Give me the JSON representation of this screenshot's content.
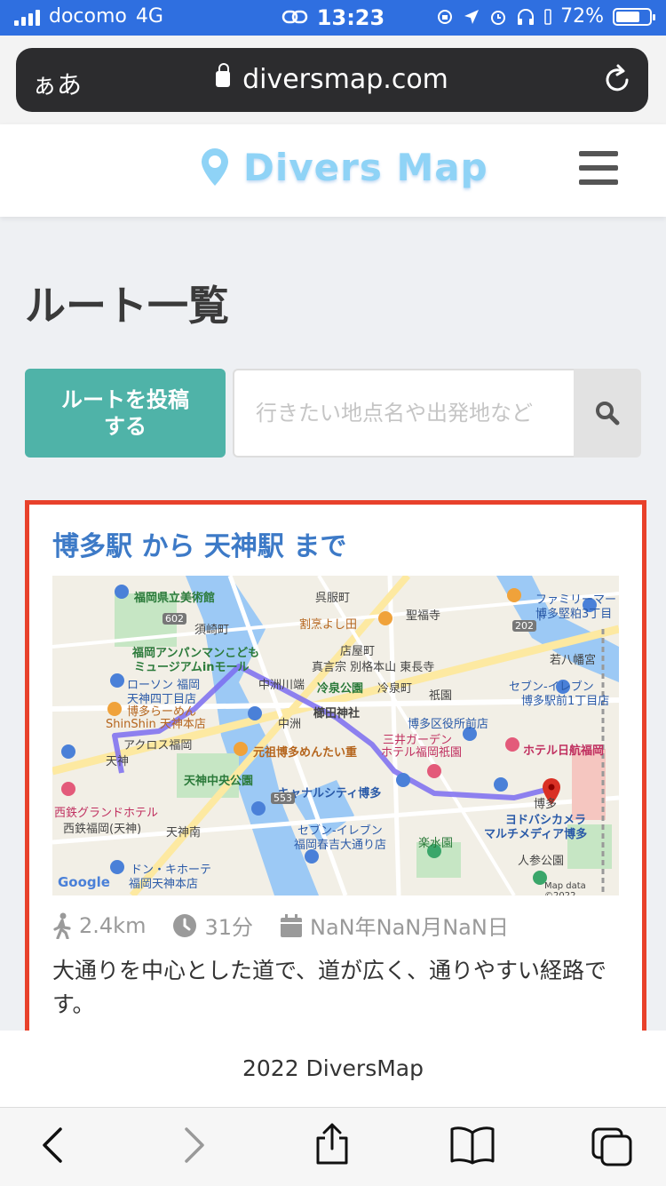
{
  "status_bar": {
    "carrier": "docomo",
    "network": "4G",
    "time": "13:23",
    "battery": "72%"
  },
  "browser": {
    "text_size_label": "ぁあ",
    "url": "diversmap.com"
  },
  "site": {
    "logo_text": "Divers Map"
  },
  "page": {
    "title": "ルート一覧",
    "post_button_label": "ルートを投稿する",
    "search_placeholder": "行きたい地点名や出発地など"
  },
  "route_card": {
    "title": "博多駅 から 天神駅 まで",
    "distance": "2.4km",
    "duration": "31分",
    "date": "NaN年NaN月NaN日",
    "description": "大通りを中心とした道で、道が広く、通りやすい経路です。",
    "map": {
      "labels": [
        "福岡県立美術館",
        "須崎町",
        "呉服町",
        "聖福寺",
        "割烹よし田",
        "福岡アンパンマンこども",
        "ミュージアムinモール",
        "店屋町",
        "真言宗 別格本山 東長寺",
        "冷泉公園",
        "冷泉町",
        "ローソン 福岡",
        "天神四丁目店",
        "中洲川端",
        "櫛田神社",
        "祇園",
        "博多らーめん",
        "ShinShin 天神本店",
        "中洲",
        "アクロス福岡",
        "元祖博多めんたい重",
        "三井ガーデン",
        "ホテル福岡祇園",
        "天神",
        "天神中央公園",
        "キャナルシティ博多",
        "西鉄グランドホテル",
        "西鉄福岡(天神)",
        "天神南",
        "セブン-イレブン",
        "福岡春吉大通り店",
        "ドン・キホーテ",
        "福岡天神本店",
        "楽水園",
        "ホテル日航福岡",
        "ヨドバシカメラ",
        "マルチメディア博多",
        "博多",
        "人参公園",
        "若八幡宮",
        "セブン-イレブン",
        "博多駅前1丁目店",
        "ファミリーマート",
        "博多堅粕3丁目",
        "博多区役所前店",
        "Google",
        "Map data ©2022",
        "602",
        "553",
        "202"
      ]
    }
  },
  "footer": {
    "copyright": "2022 DiversMap"
  },
  "colors": {
    "status_bar": "#2f6fe0",
    "accent_teal": "#4fb3a8",
    "card_title": "#3d7ac7",
    "highlight_border": "#e8412b",
    "route_line": "#7b6cf0"
  }
}
